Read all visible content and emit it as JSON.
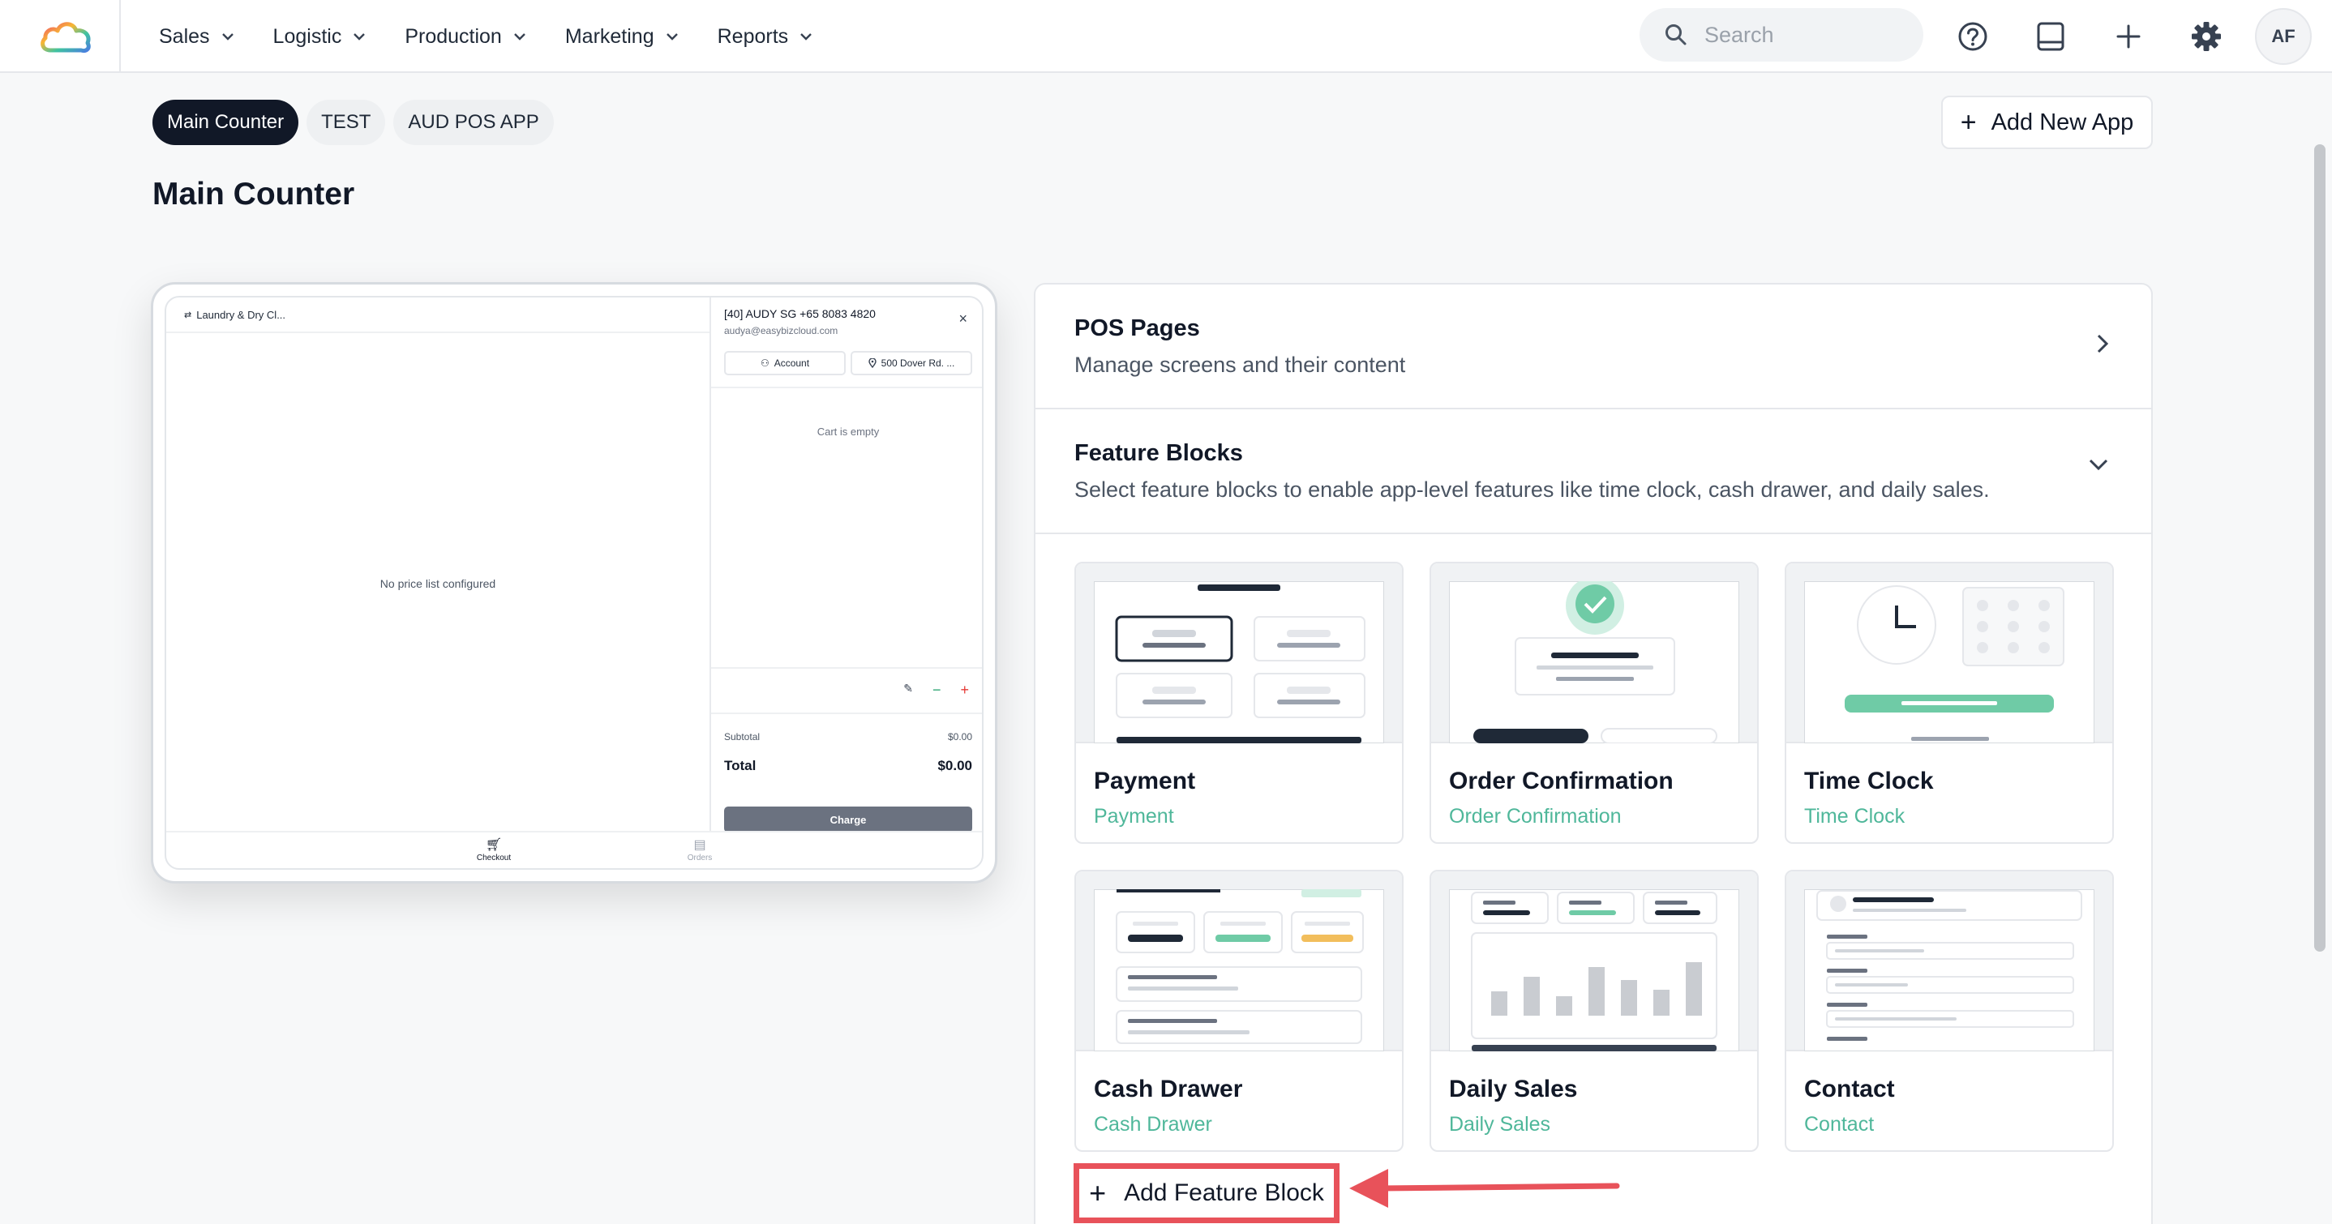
{
  "nav": {
    "items": [
      {
        "label": "Sales"
      },
      {
        "label": "Logistic"
      },
      {
        "label": "Production"
      },
      {
        "label": "Marketing"
      },
      {
        "label": "Reports"
      }
    ],
    "search_placeholder": "Search",
    "avatar_initials": "AF"
  },
  "tabs": [
    {
      "label": "Main Counter",
      "active": true
    },
    {
      "label": "TEST",
      "active": false
    },
    {
      "label": "AUD POS APP",
      "active": false
    }
  ],
  "add_app_label": "Add New App",
  "page_title": "Main Counter",
  "preview": {
    "store_name": "Laundry & Dry Cl...",
    "no_price_list": "No price list configured",
    "customer_name": "[40] AUDY SG +65 8083 4820",
    "customer_email": "audya@easybizcloud.com",
    "account_label": "Account",
    "address_label": "500 Dover Rd. ...",
    "cart_empty": "Cart is empty",
    "subtotal_label": "Subtotal",
    "subtotal_value": "$0.00",
    "total_label": "Total",
    "total_value": "$0.00",
    "charge_label": "Charge",
    "nav_checkout": "Checkout",
    "nav_orders": "Orders"
  },
  "sections": {
    "pos_pages": {
      "title": "POS Pages",
      "description": "Manage screens and their content"
    },
    "feature_blocks": {
      "title": "Feature Blocks",
      "description": "Select feature blocks to enable app-level features like time clock, cash drawer, and daily sales."
    }
  },
  "feature_cards": [
    {
      "title": "Payment",
      "subtitle": "Payment"
    },
    {
      "title": "Order Confirmation",
      "subtitle": "Order Confirmation"
    },
    {
      "title": "Time Clock",
      "subtitle": "Time Clock"
    },
    {
      "title": "Cash Drawer",
      "subtitle": "Cash Drawer"
    },
    {
      "title": "Daily Sales",
      "subtitle": "Daily Sales"
    },
    {
      "title": "Contact",
      "subtitle": "Contact"
    }
  ],
  "add_feature_block_label": "Add Feature Block",
  "colors": {
    "accent_green": "#4fb79a",
    "highlight_red": "#e8525a",
    "active_tab": "#111827"
  }
}
